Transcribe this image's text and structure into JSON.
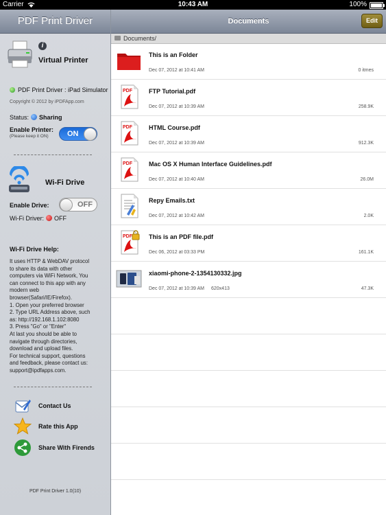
{
  "status_bar": {
    "carrier": "Carrier",
    "time": "10:43 AM",
    "battery": "100%"
  },
  "sidebar": {
    "title": "PDF Print Driver",
    "virtual_printer": {
      "title": "Virtual Printer",
      "printer_name": "PDF Print Driver : iPad Simulator",
      "copyright": "Copyright © 2012 by iPDFApp.com",
      "status_label": "Status:",
      "status_value": "Sharing",
      "enable_label": "Enable Printer:",
      "enable_hint": "(Please keep it ON)",
      "toggle_state": "ON"
    },
    "separator": "-----------------------------------",
    "wifi_drive": {
      "title": "Wi-Fi Drive",
      "enable_label": "Enable Drive:",
      "toggle_state": "OFF",
      "status_label": "Wi-Fi Driver:",
      "status_value": "OFF"
    },
    "help": {
      "title": "Wi-Fi Drive Help:",
      "lines": [
        "It uses HTTP & WebDAV protocol",
        "to share its data with other",
        "computers via WiFi Network, You",
        "can connect to this app with any",
        "modern web",
        "browser(Safari/IE/Firefox).",
        "1. Open your preferred browser",
        "2. Type URL Address above, such",
        "as: http://192.168.1.102:8080",
        "3. Press \"Go\" or \"Enter\"",
        "At last you should be able to",
        "navigate through directories,",
        "download and upload files.",
        "For technical support, questions",
        "and feedback, please contact us:",
        "support@ipdfapps.com."
      ]
    },
    "actions": [
      {
        "label": "Contact Us",
        "icon": "contact-icon"
      },
      {
        "label": "Rate this App",
        "icon": "star-icon"
      },
      {
        "label": "Share With Firends",
        "icon": "share-icon"
      }
    ],
    "version": "PDF Print Driver 1.0(10)"
  },
  "main": {
    "title": "Documents",
    "edit_label": "Edit",
    "path": "Documents/",
    "files": [
      {
        "name": "This is an Folder",
        "date": "Dec 07, 2012 at 10:41 AM",
        "dims": "",
        "size": "0 itmes",
        "icon": "folder-icon"
      },
      {
        "name": "FTP Tutorial.pdf",
        "date": "Dec 07, 2012 at 10:39 AM",
        "dims": "",
        "size": "258.9K",
        "icon": "pdf-icon"
      },
      {
        "name": "HTML Course.pdf",
        "date": "Dec 07, 2012 at 10:39 AM",
        "dims": "",
        "size": "912.3K",
        "icon": "pdf-icon"
      },
      {
        "name": "Mac OS X Human Interface Guidelines.pdf",
        "date": "Dec 07, 2012 at 10:40 AM",
        "dims": "",
        "size": "26.0M",
        "icon": "pdf-icon"
      },
      {
        "name": "Repy Emails.txt",
        "date": "Dec 07, 2012 at 10:42 AM",
        "dims": "",
        "size": "2.0K",
        "icon": "text-file-icon"
      },
      {
        "name": "This is an PDF file.pdf",
        "date": "Dec 06, 2012 at 03:33 PM",
        "dims": "",
        "size": "161.1K",
        "icon": "locked-pdf-icon"
      },
      {
        "name": "xiaomi-phone-2-1354130332.jpg",
        "date": "Dec 07, 2012 at 10:39 AM",
        "dims": "620x413",
        "size": "47.3K",
        "icon": "image-thumbnail"
      }
    ]
  },
  "colors": {
    "accent_blue": "#1f6fdc",
    "folder_red": "#d41a1a",
    "edit_button": "#8a7726"
  }
}
